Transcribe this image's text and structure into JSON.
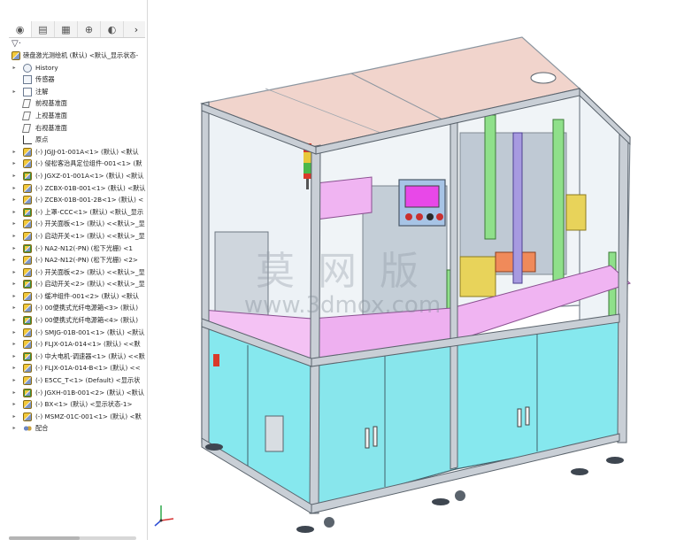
{
  "panel": {
    "tabs": [
      {
        "name": "feature-manager-tab-icon",
        "glyph": "◉"
      },
      {
        "name": "property-manager-tab-icon",
        "glyph": "▤"
      },
      {
        "name": "configuration-manager-tab-icon",
        "glyph": "▦"
      },
      {
        "name": "dimxpert-tab-icon",
        "glyph": "⊕"
      },
      {
        "name": "display-manager-tab-icon",
        "glyph": "◐"
      }
    ],
    "more_glyph": "›",
    "filter_glyph": "▽·"
  },
  "tree": {
    "root": "磅盘激光测绘机 (默认) <默认_显示状态-",
    "items": [
      {
        "label": "History",
        "icon": "history-icon",
        "expand": true
      },
      {
        "label": "传感器",
        "icon": "sensors-icon",
        "expand": false
      },
      {
        "label": "注解",
        "icon": "annotations-icon",
        "expand": true
      },
      {
        "label": "前视基准面",
        "icon": "plane-icon",
        "expand": false
      },
      {
        "label": "上视基准面",
        "icon": "plane-icon",
        "expand": false
      },
      {
        "label": "右视基准面",
        "icon": "plane-icon",
        "expand": false
      },
      {
        "label": "原点",
        "icon": "origin-icon",
        "expand": false
      },
      {
        "label": "(-) JGJJ-01-001A<1> (默认) <默认",
        "icon": "assembly-icon",
        "expand": true
      },
      {
        "label": "(-) 侵松客治具定位组件-001<1> (默",
        "icon": "assembly-icon",
        "expand": true
      },
      {
        "label": "(-) JGXZ-01-001A<1> (默认) <默认",
        "icon": "assembly-icon",
        "expand": true
      },
      {
        "label": "(-) ZCBX-01B-001<1> (默认) <默认",
        "icon": "assembly-icon",
        "expand": true
      },
      {
        "label": "(-) ZCBX-01B-001-2B<1> (默认) <",
        "icon": "assembly-icon",
        "expand": true
      },
      {
        "label": "(-) 上罩-CCC<1> (默认) <默认_显示",
        "icon": "assembly-icon",
        "expand": true
      },
      {
        "label": "(-) 开关面板<1> (默认) <<默认>_显",
        "icon": "assembly-icon",
        "expand": true
      },
      {
        "label": "(-) 启动开关<1> (默认) <<默认>_显",
        "icon": "assembly-icon",
        "expand": true
      },
      {
        "label": "(-) NA2-N12(-PN) (松下光栅) <1",
        "icon": "assembly-icon",
        "expand": true
      },
      {
        "label": "(-) NA2-N12(-PN) (松下光栅) <2>",
        "icon": "assembly-icon",
        "expand": true
      },
      {
        "label": "(-) 开关面板<2> (默认) <<默认>_显",
        "icon": "assembly-icon",
        "expand": true
      },
      {
        "label": "(-) 启动开关<2> (默认) <<默认>_显",
        "icon": "assembly-icon",
        "expand": true
      },
      {
        "label": "(-) 缓冲组件-001<2> (默认) <默认",
        "icon": "assembly-icon",
        "expand": true
      },
      {
        "label": "(-) 00便携式光纤电源箱<3> (默认)",
        "icon": "assembly-icon",
        "expand": true
      },
      {
        "label": "(-) 00便携式光纤电源箱<4> (默认)",
        "icon": "assembly-icon",
        "expand": true
      },
      {
        "label": "(-) SMJG-01B-001<1> (默认) <默认",
        "icon": "assembly-icon",
        "expand": true
      },
      {
        "label": "(-) FLJX-01A-014<1> (默认) <<默",
        "icon": "assembly-icon",
        "expand": true
      },
      {
        "label": "(-) 中大电机-调速器<1> (默认) <<默",
        "icon": "assembly-icon",
        "expand": true
      },
      {
        "label": "(-) FLJX-01A-014-B<1> (默认) <<",
        "icon": "assembly-icon",
        "expand": true
      },
      {
        "label": "(-) E5CC_T<1> (Default) <显示状",
        "icon": "assembly-icon",
        "expand": true
      },
      {
        "label": "(-) JGXH-01B-001<2> (默认) <默认",
        "icon": "assembly-icon",
        "expand": true
      },
      {
        "label": "(-) BX<1> (默认) <显示状态-1>",
        "icon": "assembly-icon",
        "expand": true
      },
      {
        "label": "(-) MSMZ-01C-001<1> (默认) <默",
        "icon": "assembly-icon",
        "expand": true
      },
      {
        "label": "配合",
        "icon": "mates-icon",
        "expand": true
      }
    ]
  },
  "watermark": {
    "line1": "莫 网 版",
    "line2": "www.3dmox.com"
  },
  "colors": {
    "frame": "#c9cfd6",
    "panel_cyan": "#86e8ee",
    "plate_pink": "#f0b4f2",
    "top_salmon": "#e9b4a6",
    "hmi_blue": "#a7c4e6",
    "glass": "#eaf2f7"
  }
}
